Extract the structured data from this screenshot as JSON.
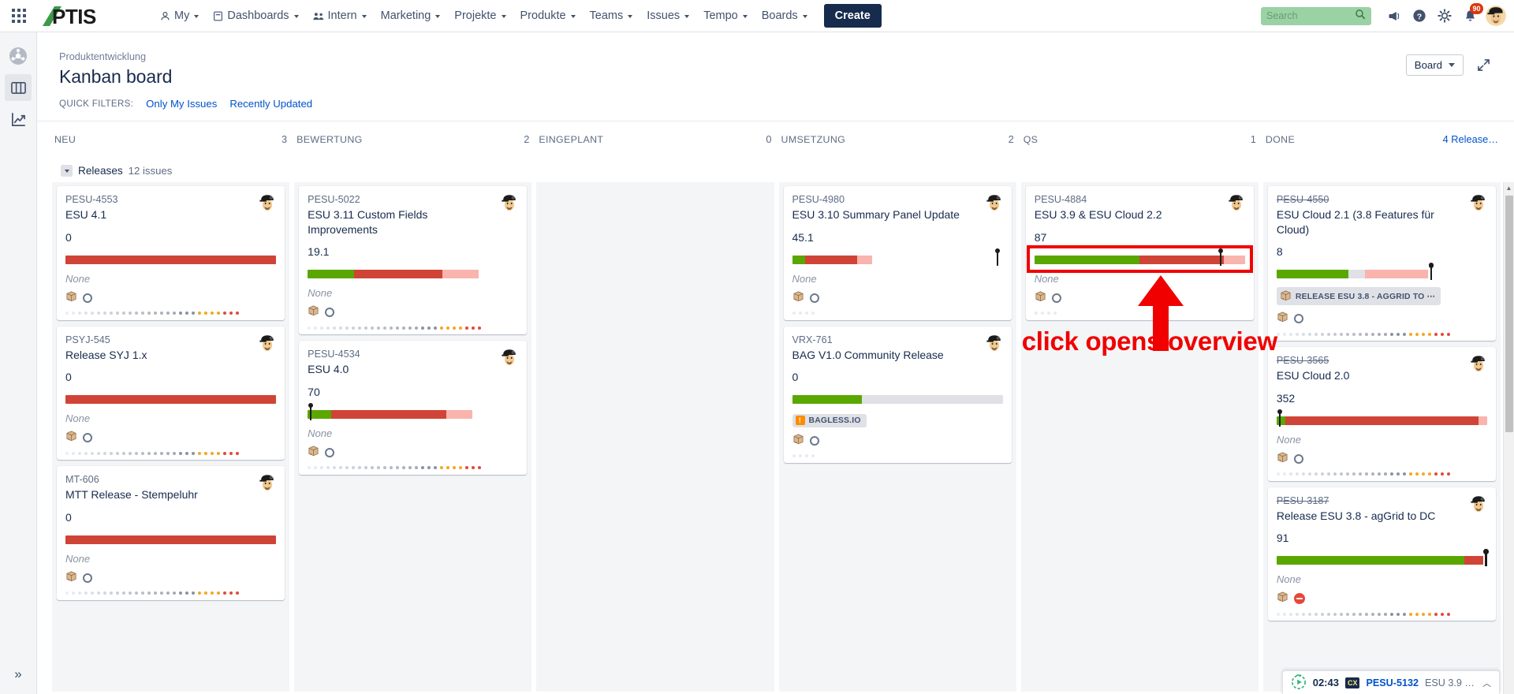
{
  "topnav": {
    "app_switcher_icon": "grid-apps-icon",
    "logo_text": "APTIS",
    "items": [
      {
        "label": "My",
        "icon": "person-icon",
        "has_caret": true
      },
      {
        "label": "Dashboards",
        "icon": "dashboard-icon",
        "has_caret": true
      },
      {
        "label": "Intern",
        "icon": "people-icon",
        "has_caret": true
      },
      {
        "label": "Marketing",
        "icon": "",
        "has_caret": true
      },
      {
        "label": "Projekte",
        "icon": "",
        "has_caret": true
      },
      {
        "label": "Produkte",
        "icon": "",
        "has_caret": true
      },
      {
        "label": "Teams",
        "icon": "",
        "has_caret": true
      },
      {
        "label": "Issues",
        "icon": "",
        "has_caret": true
      },
      {
        "label": "Tempo",
        "icon": "",
        "has_caret": true
      },
      {
        "label": "Boards",
        "icon": "",
        "has_caret": true
      }
    ],
    "create_label": "Create",
    "search_placeholder": "Search",
    "search_value": "",
    "search_bg": "#9bd2a5",
    "notifications_count": "90",
    "right_icons": [
      "megaphone-icon",
      "help-icon",
      "settings-gear-icon",
      "notification-bell-icon",
      "user-avatar"
    ]
  },
  "rail": {
    "items": [
      {
        "name": "project-logo-icon",
        "active": false
      },
      {
        "name": "board-columns-icon",
        "active": true
      },
      {
        "name": "reports-chart-icon",
        "active": false
      }
    ],
    "expand_label": "»"
  },
  "header": {
    "breadcrumb": "Produktentwicklung",
    "title": "Kanban board",
    "quick_filters_label": "QUICK FILTERS:",
    "quick_filters": [
      "Only My Issues",
      "Recently Updated"
    ],
    "board_select_label": "Board",
    "fullscreen_icon": "expand-icon"
  },
  "swimlane": {
    "title": "Releases",
    "count": "12 issues",
    "expanded": true
  },
  "columns": [
    {
      "name": "NEU",
      "count": "3",
      "count_is_link": false
    },
    {
      "name": "BEWERTUNG",
      "count": "2",
      "count_is_link": false
    },
    {
      "name": "EINGEPLANT",
      "count": "0",
      "count_is_link": false
    },
    {
      "name": "UMSETZUNG",
      "count": "2",
      "count_is_link": false
    },
    {
      "name": "QS",
      "count": "1",
      "count_is_link": false
    },
    {
      "name": "DONE",
      "count": "4 Release…",
      "count_is_link": true
    }
  ],
  "cards": {
    "neu": [
      {
        "key": "PESU-4553",
        "key_done": false,
        "title": "ESU 4.1",
        "number": "0",
        "bar": [
          {
            "color": "#d04437",
            "pct": 100
          }
        ],
        "marker_pct": null,
        "label": "None",
        "chip": null,
        "footer_icons": [
          "package-box-icon",
          "status-circle-icon"
        ],
        "dots": true
      },
      {
        "key": "PSYJ-545",
        "key_done": false,
        "title": "Release SYJ 1.x",
        "number": "0",
        "bar": [
          {
            "color": "#d04437",
            "pct": 100
          }
        ],
        "marker_pct": null,
        "label": "None",
        "chip": null,
        "footer_icons": [
          "package-box-icon",
          "status-circle-icon"
        ],
        "dots": true
      },
      {
        "key": "MT-606",
        "key_done": false,
        "title": "MTT Release - Stempeluhr",
        "number": "0",
        "bar": [
          {
            "color": "#d04437",
            "pct": 100
          }
        ],
        "marker_pct": null,
        "label": "None",
        "chip": null,
        "footer_icons": [
          "package-box-icon",
          "status-circle-icon"
        ],
        "dots": true
      }
    ],
    "bewertung": [
      {
        "key": "PESU-5022",
        "key_done": false,
        "title": "ESU 3.11 Custom Fields Improvements",
        "number": "19.1",
        "bar": [
          {
            "color": "#5aa700",
            "pct": 22
          },
          {
            "color": "#d04437",
            "pct": 42
          },
          {
            "color": "#f8b4ad",
            "pct": 17
          }
        ],
        "marker_pct": null,
        "label": "None",
        "chip": null,
        "footer_icons": [
          "package-box-icon",
          "status-circle-icon"
        ],
        "dots": true
      },
      {
        "key": "PESU-4534",
        "key_done": false,
        "title": "ESU 4.0",
        "number": "70",
        "bar": [
          {
            "color": "#5aa700",
            "pct": 11
          },
          {
            "color": "#d04437",
            "pct": 55
          },
          {
            "color": "#f8b4ad",
            "pct": 12
          }
        ],
        "marker_pct": 1,
        "label": "None",
        "chip": null,
        "footer_icons": [
          "package-box-icon",
          "status-circle-icon"
        ],
        "dots": true
      }
    ],
    "eingeplant": [],
    "umsetzung": [
      {
        "key": "PESU-4980",
        "key_done": false,
        "title": "ESU 3.10 Summary Panel Update",
        "number": "45.1",
        "bar": [
          {
            "color": "#5aa700",
            "pct": 6
          },
          {
            "color": "#d04437",
            "pct": 25
          },
          {
            "color": "#f8b4ad",
            "pct": 7
          },
          {
            "color": "#ffffff",
            "pct": 62
          }
        ],
        "marker_pct": 97,
        "label": "None",
        "chip": null,
        "footer_icons": [
          "package-box-icon",
          "status-circle-icon"
        ],
        "dots": false
      },
      {
        "key": "VRX-761",
        "key_done": false,
        "title": "BAG V1.0 Community Release",
        "number": "0",
        "bar": [
          {
            "color": "#5aa700",
            "pct": 33
          },
          {
            "color": "#dfe1e6",
            "pct": 67
          }
        ],
        "marker_pct": null,
        "label": null,
        "chip": {
          "text": "BAGLESS.IO",
          "icon": "priority-major-icon"
        },
        "footer_icons": [
          "package-box-icon",
          "status-circle-icon"
        ],
        "dots": false
      }
    ],
    "qs": [
      {
        "key": "PESU-4884",
        "key_done": false,
        "title": "ESU 3.9 & ESU Cloud 2.2",
        "number": "87",
        "bar": [
          {
            "color": "#5aa700",
            "pct": 50
          },
          {
            "color": "#d04437",
            "pct": 40
          },
          {
            "color": "#f8b4ad",
            "pct": 10
          }
        ],
        "marker_pct": 88,
        "label": "None",
        "chip": null,
        "footer_icons": [
          "package-box-icon",
          "status-circle-icon"
        ],
        "dots": false,
        "highlighted": true
      }
    ],
    "done": [
      {
        "key": "PESU-4550",
        "key_done": true,
        "title": "ESU Cloud 2.1 (3.8 Features für Cloud)",
        "number": "8",
        "bar": [
          {
            "color": "#5aa700",
            "pct": 34
          },
          {
            "color": "#dfe1e6",
            "pct": 8
          },
          {
            "color": "#f8b4ad",
            "pct": 30
          },
          {
            "color": "#ffffff",
            "pct": 28
          }
        ],
        "marker_pct": 73,
        "label": null,
        "chip": {
          "text": "RELEASE ESU 3.8 - AGGRID TO ⋯",
          "icon": "package-box-icon"
        },
        "footer_icons": [
          "package-box-icon",
          "status-circle-icon"
        ],
        "dots": true
      },
      {
        "key": "PESU-3565",
        "key_done": true,
        "title": "ESU Cloud 2.0",
        "number": "352",
        "bar": [
          {
            "color": "#5aa700",
            "pct": 4
          },
          {
            "color": "#d04437",
            "pct": 92
          },
          {
            "color": "#f8b4ad",
            "pct": 4
          }
        ],
        "marker_pct": 1,
        "label": "None",
        "chip": null,
        "footer_icons": [
          "package-box-icon",
          "status-circle-icon"
        ],
        "dots": true
      },
      {
        "key": "PESU-3187",
        "key_done": true,
        "title": "Release ESU 3.8 - agGrid to DC",
        "number": "91",
        "bar": [
          {
            "color": "#5aa700",
            "pct": 89
          },
          {
            "color": "#d04437",
            "pct": 9
          }
        ],
        "marker_pct": 99,
        "label": "None",
        "chip": null,
        "footer_icons": [
          "package-box-icon",
          "blocked-icon"
        ],
        "dots": true
      }
    ]
  },
  "annotation": {
    "text": "click opens overview",
    "color": "#f10000",
    "target": "PESU-4884 progress bar"
  },
  "tempo_widget": {
    "timer": "02:43",
    "project_badge": "CX",
    "issue_key": "PESU-5132",
    "issue_summary": "ESU 3.9 …",
    "caret_icon": "chevron-up-icon"
  },
  "scrollbar": {
    "up_arrow_icon": "caret-up-icon"
  }
}
